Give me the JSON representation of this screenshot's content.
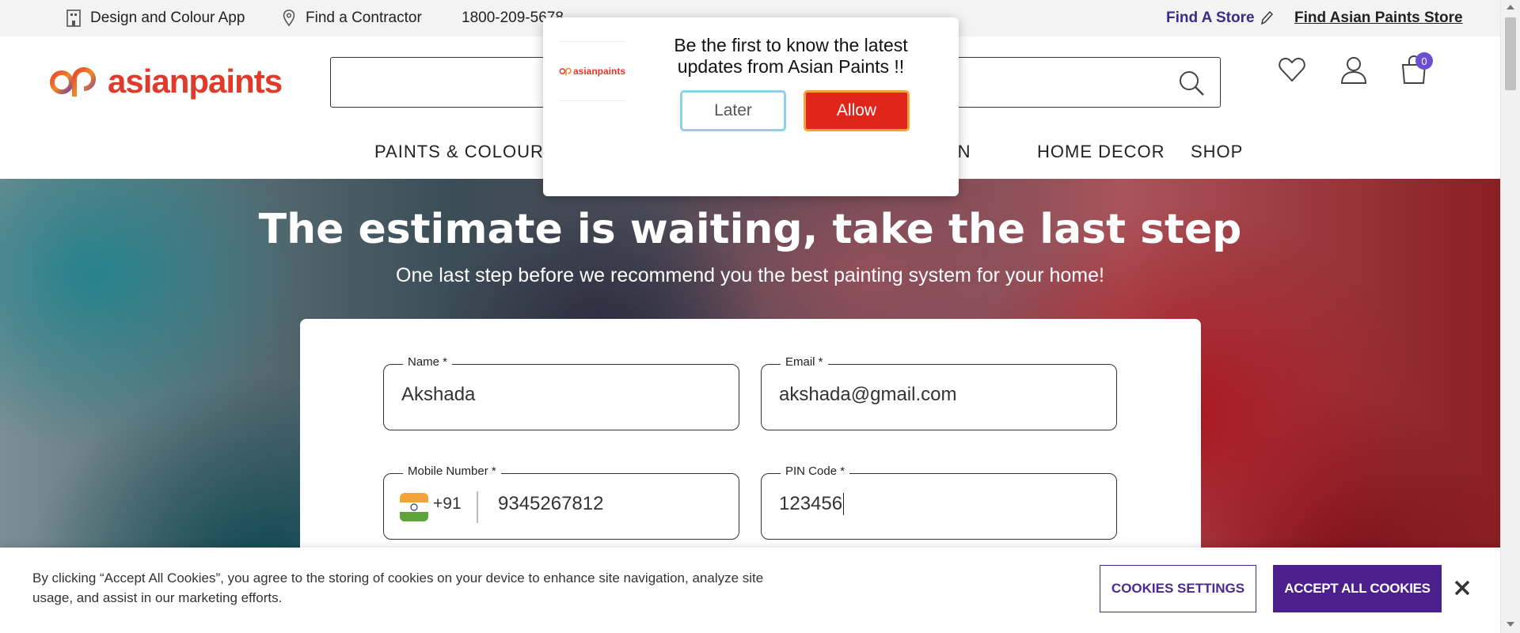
{
  "utility_bar": {
    "design_app": "Design and Colour App",
    "find_contractor": "Find a Contractor",
    "phone": "1800-209-5678",
    "find_store": "Find A Store",
    "find_ap_store": "Find Asian Paints Store"
  },
  "header": {
    "logo_text": "asianpaints",
    "search_placeholder": "",
    "cart_count": "0",
    "nav": [
      "PAINTS & COLOURS",
      "TION",
      "HOME DECOR",
      "SHOP"
    ]
  },
  "hero": {
    "title": "The estimate is waiting, take the last step",
    "subtitle": "One last step before we recommend you the best painting system for your home!"
  },
  "form": {
    "name_label": "Name *",
    "name_value": "Akshada",
    "email_label": "Email *",
    "email_value": "akshada@gmail.com",
    "mobile_label": "Mobile Number *",
    "country_code": "+91",
    "mobile_value": "9345267812",
    "pin_label": "PIN Code *",
    "pin_value": "123456"
  },
  "notification": {
    "logo_text": "asianpaints",
    "message": "Be the first to know the latest updates from Asian Paints !!",
    "later": "Later",
    "allow": "Allow"
  },
  "cookie_banner": {
    "text": "By clicking “Accept All Cookies”, you agree to the storing of cookies on your device to enhance site navigation, analyze site usage, and assist in our marketing efforts.",
    "settings": "COOKIES SETTINGS",
    "accept": "ACCEPT ALL COOKIES"
  },
  "colors": {
    "brand_red": "#e03a2b",
    "brand_purple": "#4b1f8c",
    "allow_red": "#e0251b",
    "badge": "#6a4fd1"
  }
}
